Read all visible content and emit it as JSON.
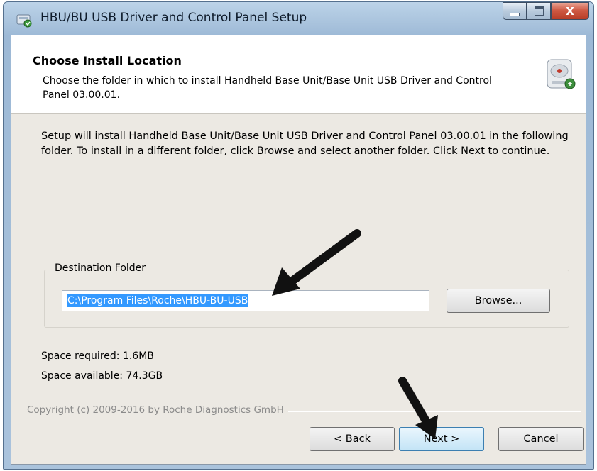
{
  "window": {
    "title": "HBU/BU USB Driver and Control Panel Setup",
    "close_glyph": "X"
  },
  "header": {
    "title": "Choose Install Location",
    "subtitle": "Choose the folder in which to install Handheld Base Unit/Base Unit USB Driver and Control Panel 03.00.01.",
    "icon": "installer-disk-icon"
  },
  "body": {
    "intro": "Setup will install Handheld Base Unit/Base Unit USB Driver and Control Panel 03.00.01 in the following folder. To install in a different folder, click Browse and select another folder. Click Next to continue."
  },
  "destination": {
    "legend": "Destination Folder",
    "path": "C:\\Program Files\\Roche\\HBU-BU-USB",
    "browse_label": "Browse..."
  },
  "space": {
    "required": "Space required: 1.6MB",
    "available": "Space available: 74.3GB"
  },
  "footer": {
    "copyright": "Copyright (c) 2009-2016 by Roche Diagnostics GmbH",
    "back_label": "< Back",
    "next_label": "Next >",
    "cancel_label": "Cancel"
  },
  "colors": {
    "selection": "#3399ff",
    "close_button": "#cf5a44",
    "dialog_bg": "#ece9e3"
  }
}
